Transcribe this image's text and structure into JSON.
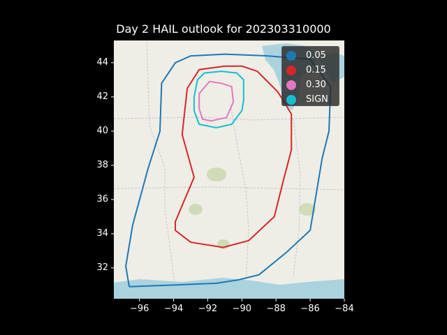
{
  "title": "Day 2 HAIL outlook for 202303310000",
  "map": {
    "xlim": [
      -97.5,
      -84.0
    ],
    "ylim": [
      30.2,
      45.3
    ],
    "basemap": "OpenStreetMap",
    "xticks": [
      -96,
      -94,
      -92,
      -90,
      -88,
      -86,
      -84
    ],
    "xtick_labels": [
      "−96",
      "−94",
      "−92",
      "−90",
      "−88",
      "−86",
      "−84"
    ],
    "yticks": [
      32,
      34,
      36,
      38,
      40,
      42,
      44
    ],
    "ytick_labels": [
      "32",
      "34",
      "36",
      "38",
      "40",
      "42",
      "44"
    ],
    "outlines": [
      {
        "label": "0.05",
        "color": "#1f77b4",
        "points": [
          [
            -96.6,
            30.9
          ],
          [
            -96.8,
            32.1
          ],
          [
            -96.4,
            34.5
          ],
          [
            -95.5,
            37.8
          ],
          [
            -94.8,
            40.0
          ],
          [
            -94.7,
            42.8
          ],
          [
            -93.9,
            44.0
          ],
          [
            -93.0,
            44.4
          ],
          [
            -91.0,
            44.5
          ],
          [
            -88.5,
            44.4
          ],
          [
            -86.0,
            44.2
          ],
          [
            -84.8,
            42.6
          ],
          [
            -84.9,
            40.0
          ],
          [
            -85.3,
            38.4
          ],
          [
            -86.0,
            34.2
          ],
          [
            -87.4,
            32.9
          ],
          [
            -89.0,
            31.6
          ],
          [
            -90.2,
            31.3
          ],
          [
            -91.5,
            31.1
          ],
          [
            -94.0,
            31.0
          ],
          [
            -96.6,
            30.9
          ]
        ]
      },
      {
        "label": "0.15",
        "color": "#d62728",
        "points": [
          [
            -93.2,
            42.5
          ],
          [
            -92.5,
            43.6
          ],
          [
            -91.0,
            43.8
          ],
          [
            -90.0,
            43.8
          ],
          [
            -89.1,
            43.5
          ],
          [
            -87.9,
            42.3
          ],
          [
            -87.1,
            41.0
          ],
          [
            -87.1,
            38.9
          ],
          [
            -87.6,
            37.0
          ],
          [
            -88.1,
            35.0
          ],
          [
            -89.6,
            33.6
          ],
          [
            -91.1,
            33.2
          ],
          [
            -93.0,
            33.5
          ],
          [
            -93.9,
            34.2
          ],
          [
            -93.9,
            34.7
          ],
          [
            -92.8,
            37.3
          ],
          [
            -93.5,
            39.8
          ],
          [
            -93.2,
            42.5
          ]
        ]
      },
      {
        "label": "0.30",
        "color": "#e377c2",
        "points": [
          [
            -92.5,
            41.3
          ],
          [
            -92.5,
            42.2
          ],
          [
            -91.9,
            42.9
          ],
          [
            -91.2,
            42.8
          ],
          [
            -90.6,
            42.6
          ],
          [
            -90.5,
            41.7
          ],
          [
            -90.9,
            40.8
          ],
          [
            -91.8,
            40.6
          ],
          [
            -92.3,
            40.7
          ],
          [
            -92.5,
            41.3
          ]
        ]
      },
      {
        "label": "SIGN",
        "color": "#17becf",
        "points": [
          [
            -92.8,
            42.0
          ],
          [
            -92.6,
            43.0
          ],
          [
            -92.2,
            43.4
          ],
          [
            -91.2,
            43.5
          ],
          [
            -90.3,
            43.4
          ],
          [
            -89.9,
            43.0
          ],
          [
            -89.9,
            41.8
          ],
          [
            -90.0,
            41.2
          ],
          [
            -90.6,
            40.4
          ],
          [
            -91.5,
            40.2
          ],
          [
            -92.5,
            40.4
          ],
          [
            -92.8,
            41.2
          ],
          [
            -92.8,
            42.0
          ]
        ]
      }
    ]
  },
  "legend": [
    {
      "label": "0.05",
      "color": "#1f77b4"
    },
    {
      "label": "0.15",
      "color": "#d62728"
    },
    {
      "label": "0.30",
      "color": "#e377c2"
    },
    {
      "label": "SIGN",
      "color": "#17becf"
    }
  ]
}
